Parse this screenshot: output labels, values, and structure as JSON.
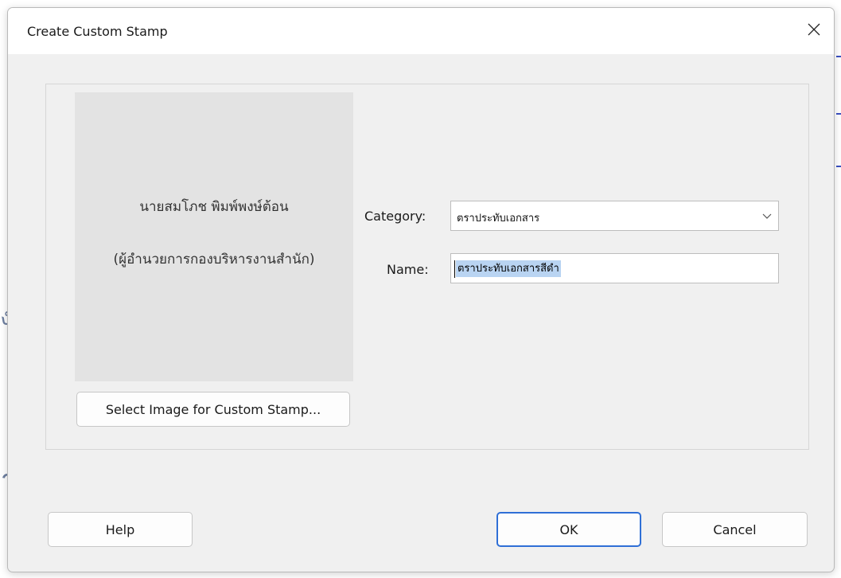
{
  "dialog": {
    "title": "Create Custom Stamp"
  },
  "preview": {
    "line1": "นายสมโภช พิมพ์พงษ์ต้อน",
    "line2": "(ผู้อำนวยการกองบริหารงานสำนัก)"
  },
  "buttons": {
    "select_image": "Select Image for Custom Stamp...",
    "help": "Help",
    "ok": "OK",
    "cancel": "Cancel"
  },
  "form": {
    "category_label": "Category:",
    "category_value": "ตราประทับเอกสาร",
    "name_label": "Name:",
    "name_value": "ตราประทับเอกสารสีดำ"
  },
  "colors": {
    "accent": "#2f6fd6",
    "selection": "#b9d4f2"
  },
  "icons": {
    "close": "close-icon",
    "dropdown": "chevron-down-icon"
  }
}
